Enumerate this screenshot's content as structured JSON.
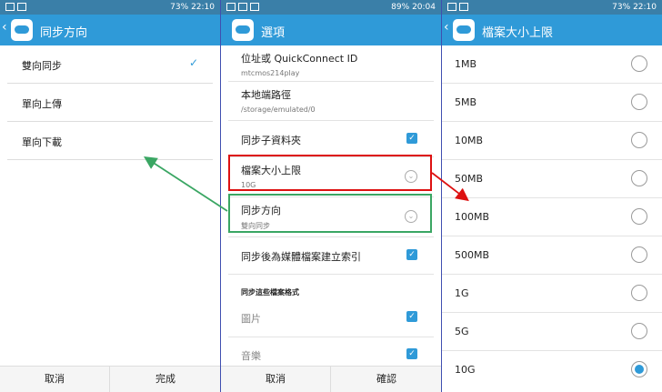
{
  "panels": [
    {
      "status": {
        "battery": "73%",
        "time": "22:10"
      },
      "title": "同步方向",
      "items": [
        "雙向同步",
        "單向上傳",
        "單向下載"
      ],
      "selected": 0,
      "buttons": [
        "取消",
        "完成"
      ]
    },
    {
      "status": {
        "battery": "89%",
        "time": "20:04"
      },
      "title": "選項",
      "settings": [
        {
          "title": "位址或 QuickConnect ID",
          "value": "mtcmos214play"
        },
        {
          "title": "本地端路徑",
          "value": "/storage/emulated/0"
        },
        {
          "title": "同步子資料夾",
          "checked": true
        },
        {
          "title": "檔案大小上限",
          "value": "10G"
        },
        {
          "title": "同步方向",
          "value": "雙向同步"
        },
        {
          "title": "同步後為媒體檔案建立索引",
          "checked": true
        }
      ],
      "section_label": "同步這些檔案格式",
      "formats": [
        {
          "title": "圖片",
          "checked": true
        },
        {
          "title": "音樂",
          "checked": true
        }
      ],
      "buttons": [
        "取消",
        "確認"
      ]
    },
    {
      "status": {
        "battery": "73%",
        "time": "22:10"
      },
      "title": "檔案大小上限",
      "options": [
        "1MB",
        "5MB",
        "10MB",
        "50MB",
        "100MB",
        "500MB",
        "1G",
        "5G",
        "10G"
      ],
      "selected": 8
    }
  ],
  "colors": {
    "accent": "#2f9ad8",
    "statusbar": "#3a7fa8",
    "highlight_red": "#d11",
    "highlight_green": "#3aa663"
  },
  "icons": {
    "check": "✓",
    "back": "‹",
    "chevron": "⌄"
  }
}
